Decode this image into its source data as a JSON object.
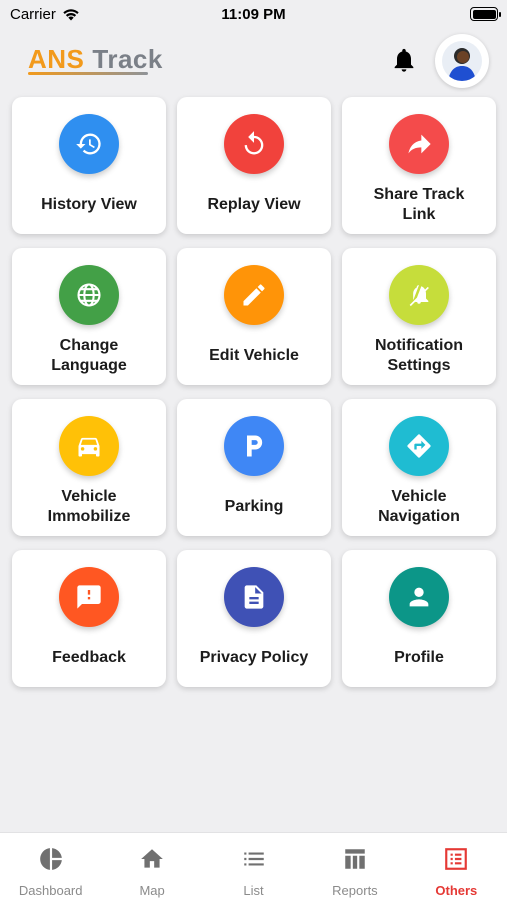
{
  "status_bar": {
    "carrier": "Carrier",
    "time": "11:09 PM"
  },
  "header": {
    "logo_part1": "ANS",
    "logo_part2": "Track"
  },
  "tiles": [
    {
      "label": "History View",
      "icon": "history-icon",
      "color": "#2f8ff0"
    },
    {
      "label": "Replay View",
      "icon": "replay-icon",
      "color": "#f1423c"
    },
    {
      "label": "Share Track\nLink",
      "icon": "share-icon",
      "color": "#f44b4b"
    },
    {
      "label": "Change\nLanguage",
      "icon": "globe-icon",
      "color": "#43a047"
    },
    {
      "label": "Edit Vehicle",
      "icon": "edit-icon",
      "color": "#ff9408"
    },
    {
      "label": "Notification\nSettings",
      "icon": "notification-settings-icon",
      "color": "#c6dd3b"
    },
    {
      "label": "Vehicle\nImmobilize",
      "icon": "car-icon",
      "color": "#ffc107"
    },
    {
      "label": "Parking",
      "icon": "parking-icon",
      "color": "#3f87f5"
    },
    {
      "label": "Vehicle\nNavigation",
      "icon": "directions-icon",
      "color": "#1fbcd2"
    },
    {
      "label": "Feedback",
      "icon": "feedback-icon",
      "color": "#ff5722"
    },
    {
      "label": "Privacy Policy",
      "icon": "document-icon",
      "color": "#3f51b5"
    },
    {
      "label": "Profile",
      "icon": "person-icon",
      "color": "#0c9688"
    }
  ],
  "tabbar": {
    "items": [
      {
        "label": "Dashboard",
        "icon": "pie-chart-icon",
        "active": false
      },
      {
        "label": "Map",
        "icon": "home-icon",
        "active": false
      },
      {
        "label": "List",
        "icon": "list-icon",
        "active": false
      },
      {
        "label": "Reports",
        "icon": "table-icon",
        "active": false
      },
      {
        "label": "Others",
        "icon": "others-icon",
        "active": true
      }
    ],
    "active_color": "#e53935",
    "inactive_color": "#707070"
  }
}
